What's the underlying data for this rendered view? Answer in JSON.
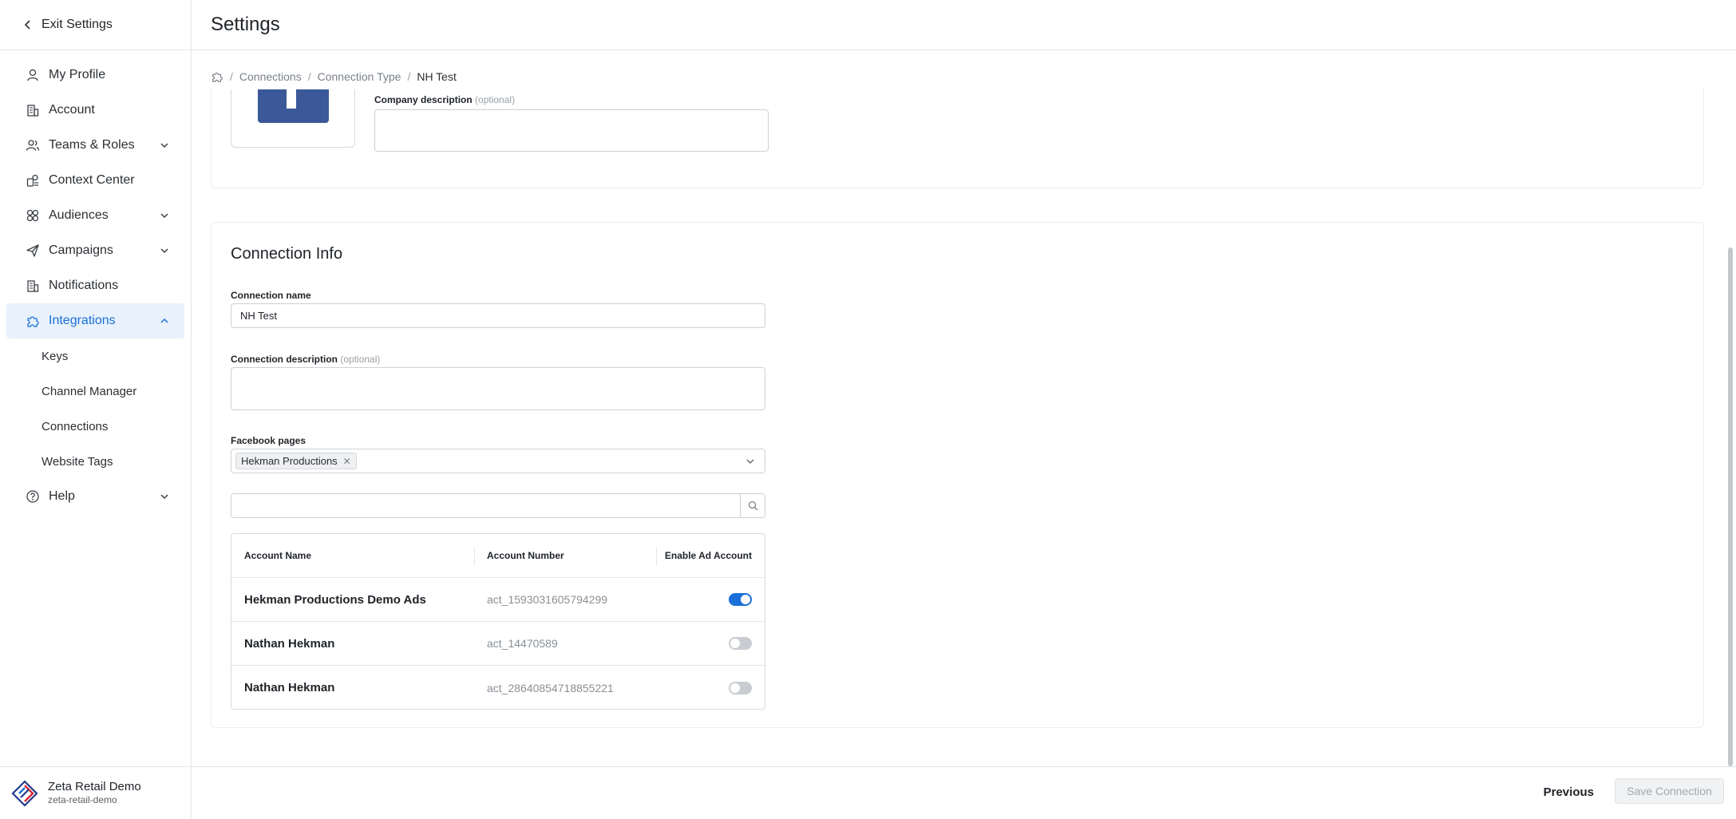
{
  "sidebar": {
    "exit_label": "Exit Settings",
    "items": [
      {
        "label": "My Profile",
        "icon": "user-icon"
      },
      {
        "label": "Account",
        "icon": "building-icon"
      },
      {
        "label": "Teams & Roles",
        "icon": "team-icon"
      },
      {
        "label": "Context Center",
        "icon": "context-icon"
      },
      {
        "label": "Audiences",
        "icon": "audiences-icon"
      },
      {
        "label": "Campaigns",
        "icon": "send-icon"
      },
      {
        "label": "Notifications",
        "icon": "building-icon"
      },
      {
        "label": "Integrations",
        "icon": "puzzle-icon"
      },
      {
        "label": "Help",
        "icon": "help-icon"
      }
    ],
    "sub_items": [
      {
        "label": "Keys"
      },
      {
        "label": "Channel Manager"
      },
      {
        "label": "Connections"
      },
      {
        "label": "Website Tags"
      }
    ],
    "org": {
      "name": "Zeta Retail Demo",
      "slug": "zeta-retail-demo"
    }
  },
  "header": {
    "title": "Settings"
  },
  "breadcrumb": {
    "items": [
      "Connections",
      "Connection Type",
      "NH Test"
    ],
    "separator": "/"
  },
  "company": {
    "description_label": "Company description",
    "optional": "(optional)",
    "description_value": ""
  },
  "connection_info": {
    "heading": "Connection Info",
    "name_label": "Connection name",
    "name_value": "NH Test",
    "description_label": "Connection description",
    "optional": "(optional)",
    "description_value": "",
    "facebook_pages_label": "Facebook pages",
    "selected_page": "Hekman Productions",
    "chip_remove": "✕",
    "search_value": ""
  },
  "table": {
    "headers": [
      "Account Name",
      "Account Number",
      "Enable Ad Account"
    ],
    "rows": [
      {
        "name": "Hekman Productions Demo Ads",
        "number": "act_1593031605794299",
        "enabled": true
      },
      {
        "name": "Nathan Hekman",
        "number": "act_14470589",
        "enabled": false
      },
      {
        "name": "Nathan Hekman",
        "number": "act_28640854718855221",
        "enabled": false
      }
    ]
  },
  "footer": {
    "previous_label": "Previous",
    "save_label": "Save Connection"
  },
  "colors": {
    "accent": "#1a6fd8",
    "active_bg": "#e8f1fc",
    "facebook": "#3b5998"
  }
}
